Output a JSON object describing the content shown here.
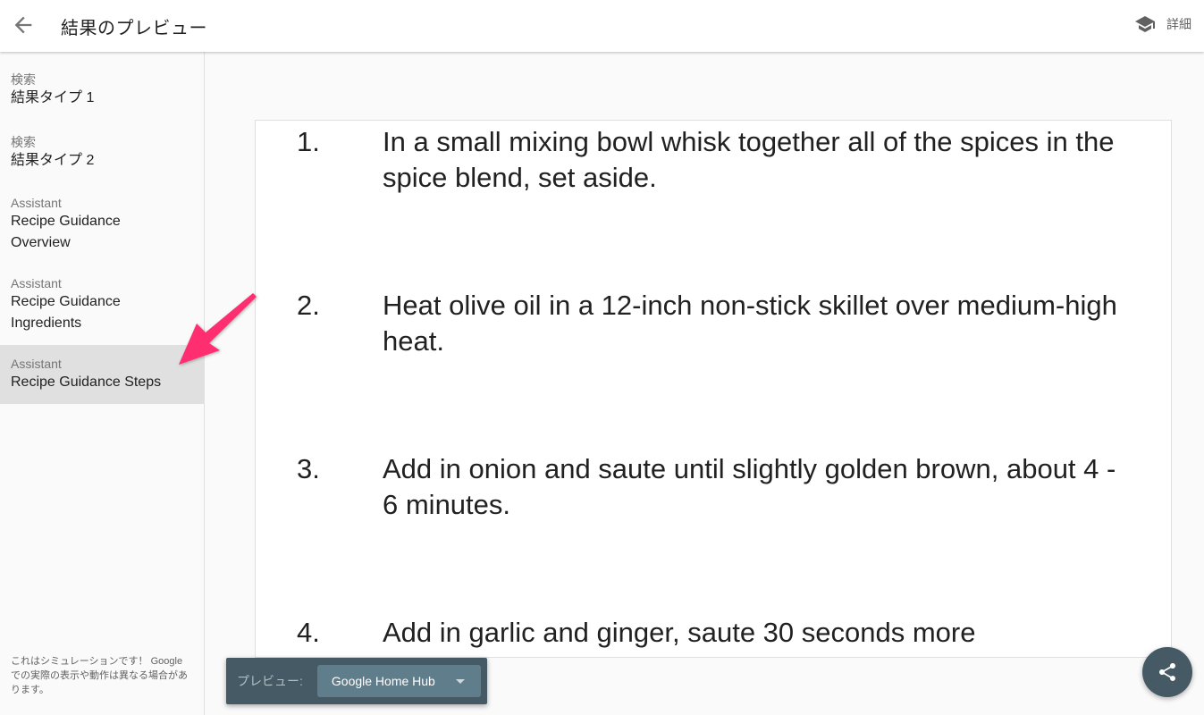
{
  "header": {
    "title": "結果のプレビュー",
    "details_label": "詳細",
    "back_icon": "arrow-back-icon",
    "details_icon": "school-icon"
  },
  "sidebar": {
    "items": [
      {
        "category": "検索",
        "label": "結果タイプ 1",
        "selected": false
      },
      {
        "category": "検索",
        "label": "結果タイプ 2",
        "selected": false
      },
      {
        "category": "Assistant",
        "label": "Recipe Guidance Overview",
        "selected": false
      },
      {
        "category": "Assistant",
        "label": "Recipe Guidance Ingredients",
        "selected": false
      },
      {
        "category": "Assistant",
        "label": "Recipe Guidance Steps",
        "selected": true
      }
    ],
    "disclaimer": "これはシミュレーションです！ Google での実際の表示や動作は異なる場合があります。"
  },
  "main": {
    "steps": [
      {
        "number": "1.",
        "text": "In a small mixing bowl whisk together all of the spices in the spice blend, set aside."
      },
      {
        "number": "2.",
        "text": "Heat olive oil in a 12-inch non-stick skillet over medium-high heat."
      },
      {
        "number": "3.",
        "text": "Add in onion and saute until slightly golden brown, about 4 - 6 minutes."
      },
      {
        "number": "4.",
        "text": "Add in garlic and ginger, saute 30 seconds more"
      }
    ]
  },
  "preview": {
    "label": "プレビュー:",
    "device": "Google Home Hub"
  },
  "fab": {
    "icon": "share-icon"
  },
  "annotation": {
    "color": "#ff2d6f"
  }
}
